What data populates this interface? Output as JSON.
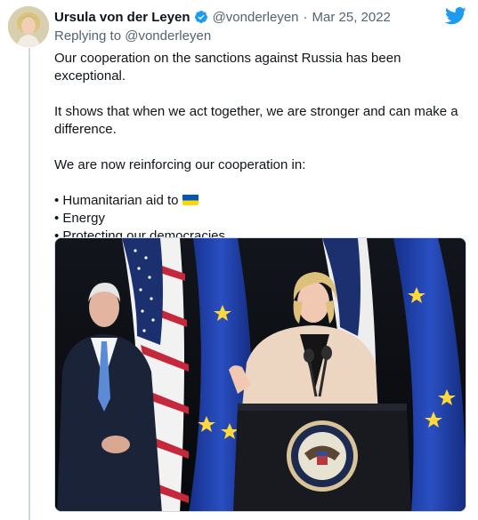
{
  "tweet": {
    "author_name": "Ursula von der Leyen",
    "handle": "@vonderleyen",
    "separator": "·",
    "date": "Mar 25, 2022",
    "reply_prefix": "Replying to",
    "reply_handle": "@vonderleyen",
    "text": {
      "line1": "Our cooperation on the sanctions against Russia has been exceptional.",
      "line2": "It shows that when we act together, we are stronger and can make a difference.",
      "line3": "We are now reinforcing our cooperation in:",
      "bullets": [
        "• Humanitarian aid to",
        "• Energy",
        "• Protecting our democracies"
      ]
    }
  },
  "icons": {
    "verified": "verified-badge-icon",
    "brand": "twitter-bird-icon",
    "flag": "ukraine-flag-icon"
  },
  "colors": {
    "brand": "#1d9bf0",
    "muted": "#536471",
    "text": "#0f1419",
    "flag_blue": "#0057b7",
    "flag_yellow": "#ffd700",
    "eu_blue": "#1f3fa6",
    "eu_star": "#ffd83a"
  }
}
